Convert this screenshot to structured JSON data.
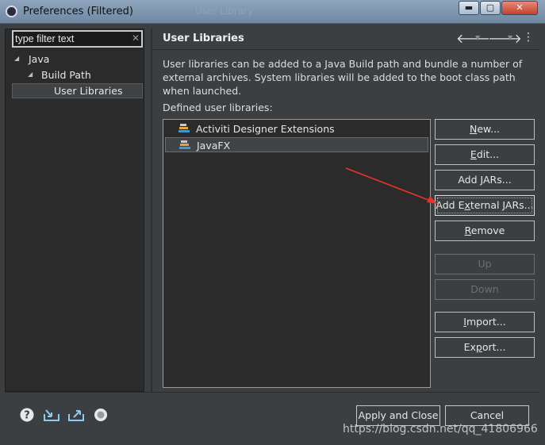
{
  "window": {
    "title": "Preferences (Filtered)",
    "ghost_title": "User Library",
    "minimize": "▬",
    "maximize": "▢",
    "close": "✕"
  },
  "sidebar": {
    "filter_placeholder": "type filter text",
    "tree": [
      {
        "label": "Java"
      },
      {
        "label": "Build Path"
      },
      {
        "label": "User Libraries",
        "selected": true
      }
    ]
  },
  "page": {
    "title": "User Libraries",
    "description": "User libraries can be added to a Java Build path and bundle a number of external archives. System libraries will be added to the boot class path when launched.",
    "defined_label": "Defined user libraries:",
    "libraries": [
      {
        "label": "Activiti Designer Extensions"
      },
      {
        "label": "JavaFX",
        "selected": true
      }
    ]
  },
  "buttons": {
    "new": {
      "pre": "",
      "u": "N",
      "post": "ew..."
    },
    "edit": {
      "pre": "",
      "u": "E",
      "post": "dit..."
    },
    "add_jars": {
      "pre": "Add ",
      "u": "J",
      "post": "ARs..."
    },
    "add_external_jars": {
      "pre": "Add E",
      "u": "x",
      "post": "ternal JARs..."
    },
    "remove": {
      "pre": "",
      "u": "R",
      "post": "emove"
    },
    "up": {
      "pre": "",
      "u": "U",
      "post": "p"
    },
    "down": {
      "pre": "",
      "u": "D",
      "post": "own"
    },
    "import": {
      "pre": "",
      "u": "I",
      "post": "mport..."
    },
    "export": {
      "pre": "Ex",
      "u": "p",
      "post": "ort..."
    }
  },
  "footer": {
    "apply_close": "Apply and Close",
    "cancel": "Cancel",
    "watermark": "https://blog.csdn.net/qq_41806966"
  },
  "colors": {
    "annotation_arrow": "#e8322c",
    "library_icon_orange": "#e8a33c",
    "library_icon_teal": "#3a9bd0"
  },
  "icons": [
    "help-icon",
    "import-preferences-icon",
    "export-preferences-icon",
    "record-icon",
    "back-arrow-icon",
    "forward-arrow-icon",
    "view-menu-icon"
  ]
}
